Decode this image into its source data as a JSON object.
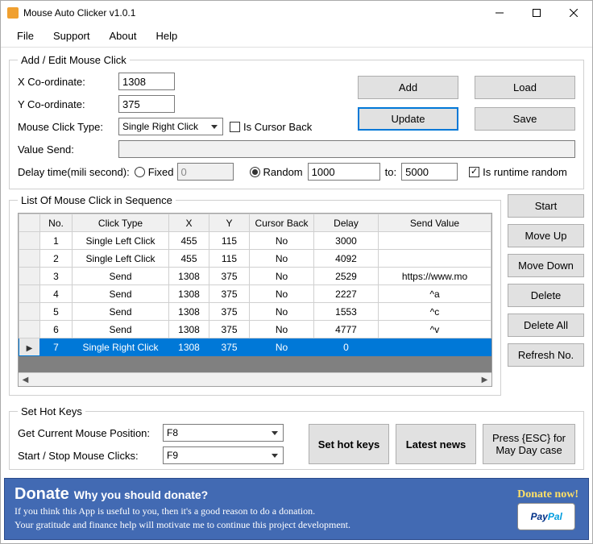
{
  "window": {
    "title": "Mouse Auto Clicker v1.0.1"
  },
  "menu": {
    "file": "File",
    "support": "Support",
    "about": "About",
    "help": "Help"
  },
  "addedit": {
    "legend": "Add / Edit Mouse Click",
    "xLabel": "X Co-ordinate:",
    "xValue": "1308",
    "yLabel": "Y Co-ordinate:",
    "yValue": "375",
    "clickTypeLabel": "Mouse Click Type:",
    "clickTypeValue": "Single Right Click",
    "isCursorBack": "Is Cursor Back",
    "valueSendLabel": "Value Send:",
    "valueSendValue": "",
    "delayLabel": "Delay time(mili second):",
    "fixedLabel": "Fixed",
    "fixedValue": "0",
    "randomLabel": "Random",
    "randomFrom": "1000",
    "toLabel": "to:",
    "randomTo": "5000",
    "isRuntimeRandom": "Is runtime random",
    "addBtn": "Add",
    "updateBtn": "Update",
    "loadBtn": "Load",
    "saveBtn": "Save"
  },
  "list": {
    "legend": "List Of Mouse Click in Sequence",
    "headers": {
      "no": "No.",
      "clickType": "Click Type",
      "x": "X",
      "y": "Y",
      "cursorBack": "Cursor Back",
      "delay": "Delay",
      "sendValue": "Send Value"
    },
    "rows": [
      {
        "no": "1",
        "clickType": "Single Left Click",
        "x": "455",
        "y": "115",
        "cursorBack": "No",
        "delay": "3000",
        "sendValue": ""
      },
      {
        "no": "2",
        "clickType": "Single Left Click",
        "x": "455",
        "y": "115",
        "cursorBack": "No",
        "delay": "4092",
        "sendValue": ""
      },
      {
        "no": "3",
        "clickType": "Send",
        "x": "1308",
        "y": "375",
        "cursorBack": "No",
        "delay": "2529",
        "sendValue": "https://www.mo"
      },
      {
        "no": "4",
        "clickType": "Send",
        "x": "1308",
        "y": "375",
        "cursorBack": "No",
        "delay": "2227",
        "sendValue": "^a"
      },
      {
        "no": "5",
        "clickType": "Send",
        "x": "1308",
        "y": "375",
        "cursorBack": "No",
        "delay": "1553",
        "sendValue": "^c"
      },
      {
        "no": "6",
        "clickType": "Send",
        "x": "1308",
        "y": "375",
        "cursorBack": "No",
        "delay": "4777",
        "sendValue": "^v"
      },
      {
        "no": "7",
        "clickType": "Single Right Click",
        "x": "1308",
        "y": "375",
        "cursorBack": "No",
        "delay": "0",
        "sendValue": ""
      }
    ],
    "sideButtons": {
      "start": "Start",
      "moveUp": "Move Up",
      "moveDown": "Move Down",
      "delete": "Delete",
      "deleteAll": "Delete All",
      "refresh": "Refresh No."
    }
  },
  "hotkeys": {
    "legend": "Set Hot Keys",
    "getPosLabel": "Get Current Mouse Position:",
    "getPosValue": "F8",
    "startStopLabel": "Start / Stop Mouse Clicks:",
    "startStopValue": "F9",
    "setBtn": "Set hot keys",
    "newsBtn": "Latest news",
    "escNote": "Press {ESC} for May Day case"
  },
  "donate": {
    "title": "Donate",
    "subtitle": "Why you should donate?",
    "line1": "If you think this App is useful to you, then it's a good reason to do a donation.",
    "line2": "Your gratitude and finance help will motivate me to continue this project development.",
    "now": "Donate now!"
  }
}
